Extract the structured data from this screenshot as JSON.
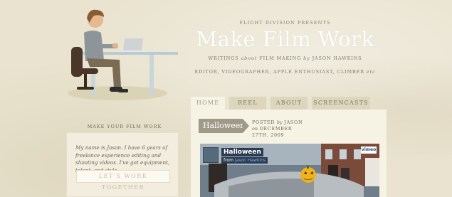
{
  "header": {
    "presents": "FLIGHT DIVISION PRESENTS",
    "title": "Make Film Work",
    "tagline_prefix": "WRITINGS",
    "tagline_about": "about",
    "tagline_subject": "FILM MAKING",
    "tagline_by": "by",
    "tagline_author": "JASON HAWKINS",
    "roles": "EDITOR, VIDEOGRAPHER, APPLE ENTHUSIAST, CLIMBER",
    "roles_suffix": "etc"
  },
  "nav": {
    "tabs": [
      {
        "label": "HOME",
        "active": true
      },
      {
        "label": "REEL",
        "active": false
      },
      {
        "label": "ABOUT",
        "active": false
      },
      {
        "label": "SCREENCASTS",
        "active": false
      }
    ]
  },
  "sidebar": {
    "heading": "MAKE YOUR FILM WORK",
    "about_text": "My name is Jason. I have 6 years of freelance experience editing and shooting videos. I've got equipment, talent, and style.",
    "cta_label": "LET'S WORK TOGETHER"
  },
  "post": {
    "category": "Halloween",
    "posted_label": "POSTED",
    "posted_by": "by",
    "author": "JASON",
    "posted_on": "on",
    "date": "DECEMBER 27TH, 2009",
    "video": {
      "title": "Halloween",
      "from_label": "from",
      "channel": "Jason Hawkins",
      "logo": "vimeo"
    }
  },
  "colors": {
    "background": "#e9e3cf",
    "panel": "#f6f2e4",
    "tab": "#ddd6bd",
    "badge": "#9f998a",
    "title": "#ffffff"
  },
  "icons": {
    "illustration": "man-at-desk-with-laptop-illustration",
    "pumpkin": "jack-o-lantern-icon"
  }
}
